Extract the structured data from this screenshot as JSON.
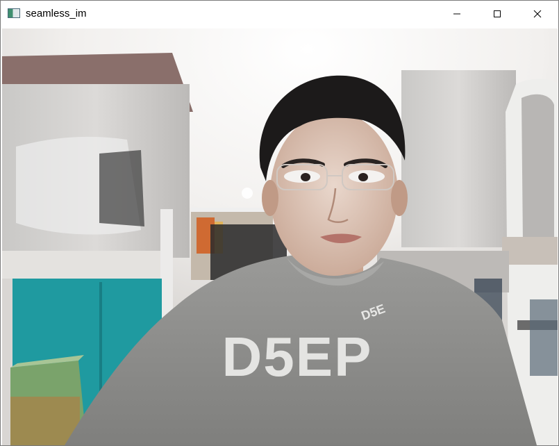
{
  "window": {
    "title": "seamless_im",
    "icon": "opencv-window-icon"
  },
  "controls": {
    "minimize": "minimize-icon",
    "maximize": "maximize-icon",
    "close": "close-icon"
  },
  "image": {
    "description_icon": "camera-frame",
    "shirt_text": "D5EP"
  },
  "colors": {
    "titlebar": "#ffffff",
    "shirt": "#8e8e8c",
    "teal_box": "#1f9aa0"
  }
}
